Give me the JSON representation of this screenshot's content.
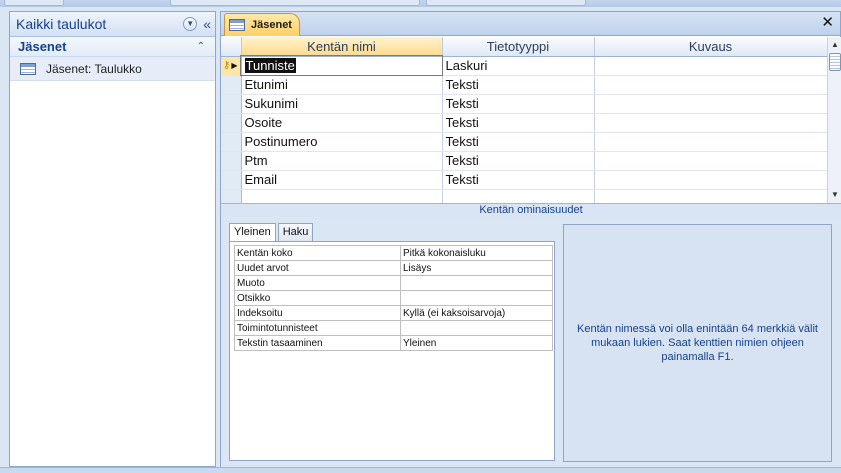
{
  "nav": {
    "title": "Kaikki taulukot",
    "group_title": "Jäsenet",
    "items": [
      {
        "label": "Jäsenet: Taulukko"
      }
    ]
  },
  "document": {
    "tab_label": "Jäsenet"
  },
  "grid": {
    "columns": [
      "Kentän nimi",
      "Tietotyyppi",
      "Kuvaus"
    ],
    "rows": [
      {
        "name": "Tunniste",
        "type": "Laskuri",
        "description": ""
      },
      {
        "name": "Etunimi",
        "type": "Teksti",
        "description": ""
      },
      {
        "name": "Sukunimi",
        "type": "Teksti",
        "description": ""
      },
      {
        "name": "Osoite",
        "type": "Teksti",
        "description": ""
      },
      {
        "name": "Postinumero",
        "type": "Teksti",
        "description": ""
      },
      {
        "name": "Ptm",
        "type": "Teksti",
        "description": ""
      },
      {
        "name": "Email",
        "type": "Teksti",
        "description": ""
      }
    ]
  },
  "properties": {
    "section_title": "Kentän ominaisuudet",
    "tabs": [
      "Yleinen",
      "Haku"
    ],
    "rows": [
      {
        "label": "Kentän koko",
        "value": "Pitkä kokonaisluku"
      },
      {
        "label": "Uudet arvot",
        "value": "Lisäys"
      },
      {
        "label": "Muoto",
        "value": ""
      },
      {
        "label": "Otsikko",
        "value": ""
      },
      {
        "label": "Indeksoitu",
        "value": "Kyllä (ei kaksoisarvoja)"
      },
      {
        "label": "Toimintotunnisteet",
        "value": ""
      },
      {
        "label": "Tekstin tasaaminen",
        "value": "Yleinen"
      }
    ],
    "help_text": "Kentän nimessä voi olla enintään 64 merkkiä välit mukaan lukien. Saat kenttien nimien ohjeen painamalla F1."
  },
  "colors": {
    "accent_tab": "#ffd066",
    "frame_blue": "#8ba7d1",
    "text_blue": "#15428b"
  },
  "icons": {
    "table": "table-icon",
    "primary_key": "key-icon",
    "row_selector": "current-row-arrow-icon",
    "close": "close-icon",
    "collapse": "double-chevron-left-icon",
    "dropdown": "chevron-down-icon",
    "group_collapse": "double-chevron-up-icon"
  }
}
